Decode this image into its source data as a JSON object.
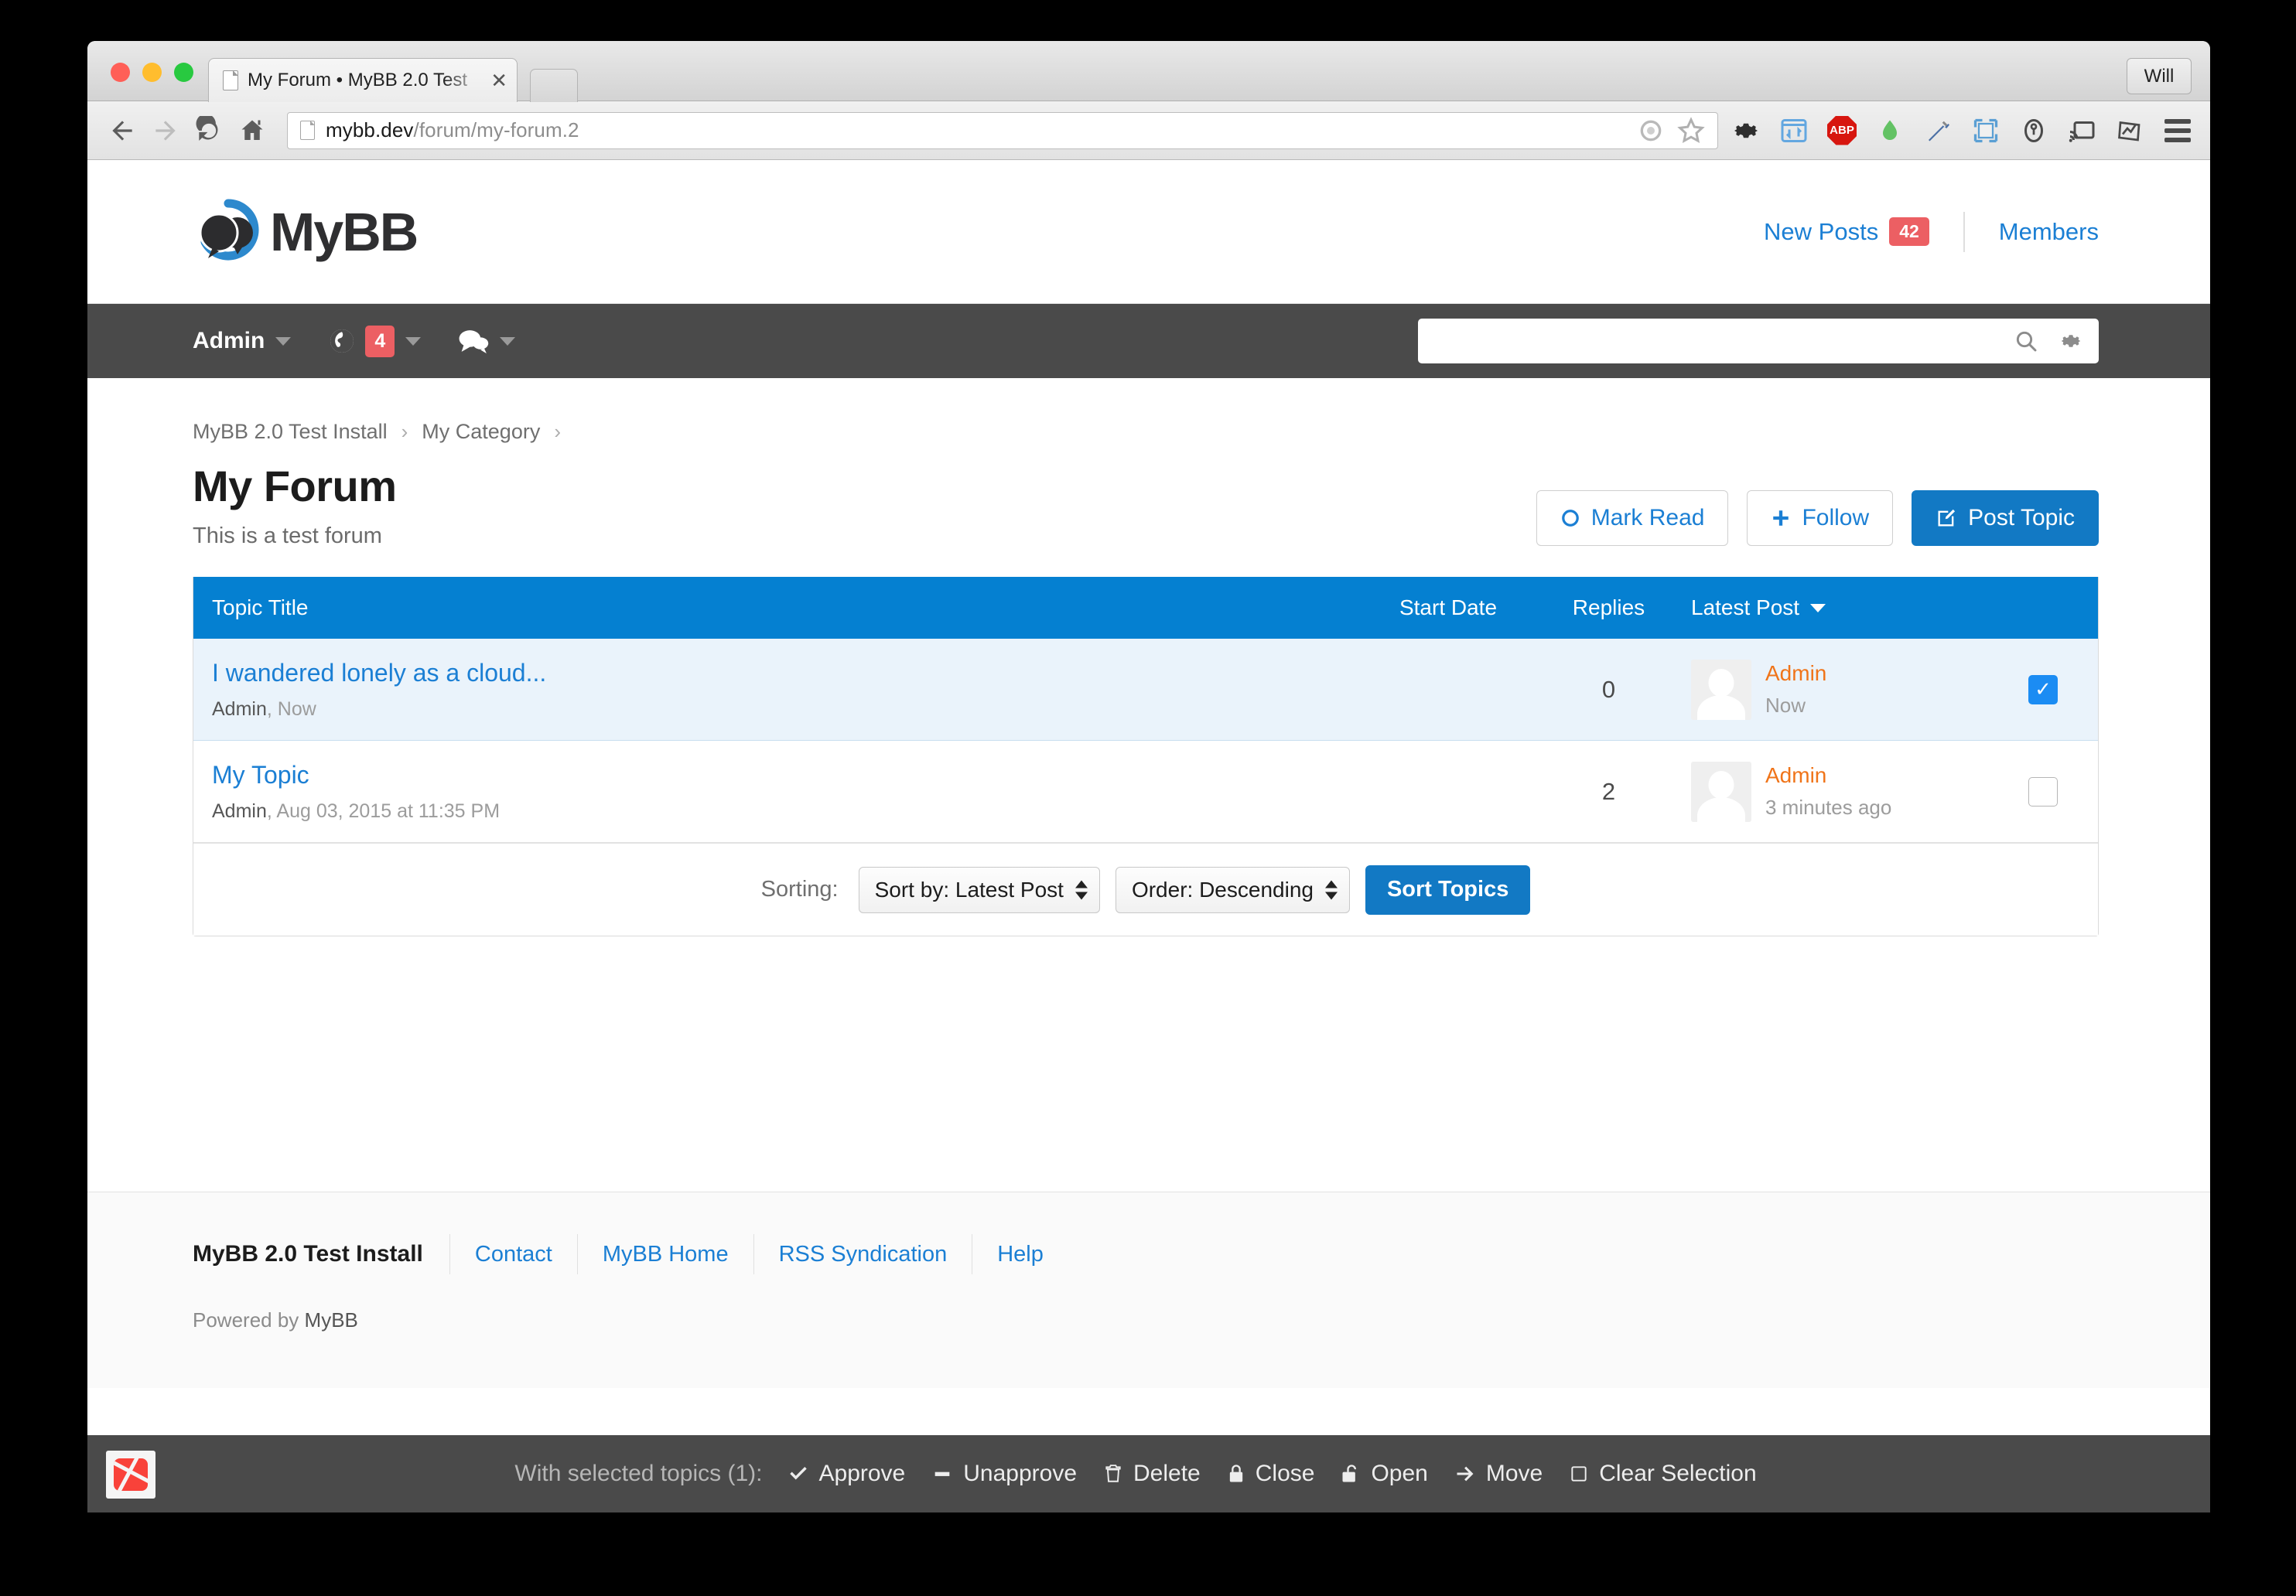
{
  "browser": {
    "tab_title": "My Forum • MyBB 2.0 Test",
    "tab_close": "✕",
    "profile_name": "Will",
    "url_host": "mybb.dev",
    "url_path": "/forum/my-forum.2",
    "abp_label": "ABP"
  },
  "site_header": {
    "logo_text": "MyBB",
    "new_posts_label": "New Posts",
    "new_posts_badge": "42",
    "members_label": "Members"
  },
  "navbar": {
    "user_label": "Admin",
    "globe_badge": "4",
    "search_placeholder": ""
  },
  "breadcrumb": {
    "items": [
      "MyBB 2.0 Test Install",
      "My Category"
    ],
    "separator": "›"
  },
  "page": {
    "title": "My Forum",
    "subtitle": "This is a test forum",
    "actions": [
      {
        "label": "Mark Read",
        "icon": "circle-icon"
      },
      {
        "label": "Follow",
        "icon": "plus-icon"
      },
      {
        "label": "Post Topic",
        "icon": "compose-icon"
      }
    ]
  },
  "table": {
    "headers": {
      "title": "Topic Title",
      "start_date": "Start Date",
      "replies": "Replies",
      "latest_post": "Latest Post"
    },
    "rows": [
      {
        "title": "I wandered lonely as a cloud...",
        "author": "Admin",
        "started": "Now",
        "replies": "0",
        "latest_user": "Admin",
        "latest_time": "Now",
        "checked": true,
        "unread": true
      },
      {
        "title": "My Topic",
        "author": "Admin",
        "started": "Aug 03, 2015 at 11:35 PM",
        "replies": "2",
        "latest_user": "Admin",
        "latest_time": "3 minutes ago",
        "checked": false,
        "unread": false
      }
    ],
    "sorting_label": "Sorting:",
    "sort_by_value": "Sort by: Latest Post",
    "order_value": "Order: Descending",
    "sort_button": "Sort Topics"
  },
  "footer": {
    "brand": "MyBB 2.0 Test Install",
    "links": [
      "Contact",
      "MyBB Home",
      "RSS Syndication",
      "Help"
    ],
    "powered_prefix": "Powered by ",
    "powered_name": "MyBB"
  },
  "action_bar": {
    "label": "With selected topics (1):",
    "items": [
      {
        "label": "Approve",
        "icon": "check-icon"
      },
      {
        "label": "Unapprove",
        "icon": "minus-icon"
      },
      {
        "label": "Delete",
        "icon": "trash-icon"
      },
      {
        "label": "Close",
        "icon": "lock-closed-icon"
      },
      {
        "label": "Open",
        "icon": "lock-open-icon"
      },
      {
        "label": "Move",
        "icon": "arrow-right-icon"
      },
      {
        "label": "Clear Selection",
        "icon": "square-icon"
      }
    ]
  },
  "colors": {
    "brand_blue": "#0580d1",
    "link_blue": "#1b7fd4",
    "badge_red": "#ec5f63",
    "accent_orange": "#f07419",
    "navbar_dark": "#4a4a4a"
  }
}
